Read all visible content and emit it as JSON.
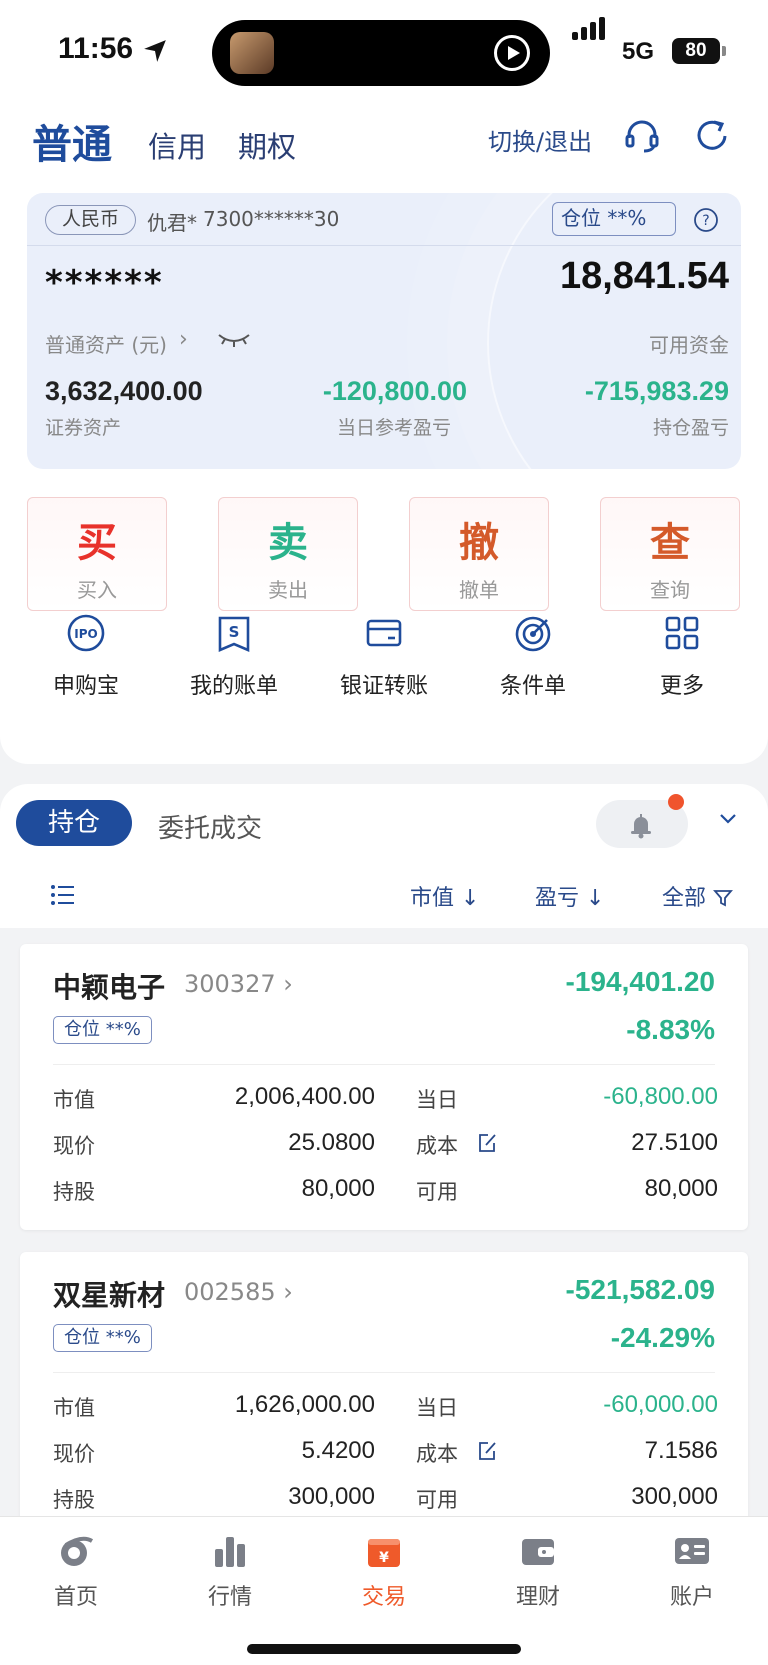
{
  "status": {
    "time": "11:56",
    "network": "5G",
    "battery": "80"
  },
  "header": {
    "tabs": [
      "普通",
      "信用",
      "期权"
    ],
    "switch_label": "切换/退出"
  },
  "account": {
    "currency": "人民币",
    "name": "仇君*",
    "number": "7300******30",
    "position_label": "仓位 **%",
    "masked_total": "******",
    "available_cash": "18,841.54",
    "asset_label": "普通资产 (元)",
    "cash_label": "可用资金",
    "securities_assets": "3,632,400.00",
    "securities_label": "证券资产",
    "today_pl": "-120,800.00",
    "today_pl_label": "当日参考盈亏",
    "holding_pl": "-715,983.29",
    "holding_pl_label": "持仓盈亏"
  },
  "trade_buttons": [
    {
      "big": "买",
      "small": "买入",
      "color": "#e8322b"
    },
    {
      "big": "卖",
      "small": "卖出",
      "color": "#2bb38c"
    },
    {
      "big": "撤",
      "small": "撤单",
      "color": "#d45a2a"
    },
    {
      "big": "查",
      "small": "查询",
      "color": "#d45a2a"
    }
  ],
  "quick_actions": [
    "申购宝",
    "我的账单",
    "银证转账",
    "条件单",
    "更多"
  ],
  "holdings_tabs": {
    "active": "持仓",
    "other": "委托成交"
  },
  "sort": {
    "market_value": "市值 ↓",
    "pl": "盈亏 ↓",
    "filter": "全部"
  },
  "stocks": [
    {
      "name": "中颖电子",
      "code": "300327",
      "pl": "-194,401.20",
      "pct": "-8.83%",
      "position": "仓位 **%",
      "market_value_label": "市值",
      "market_value": "2,006,400.00",
      "today_label": "当日",
      "today": "-60,800.00",
      "price_label": "现价",
      "price": "25.0800",
      "cost_label": "成本",
      "cost": "27.5100",
      "shares_label": "持股",
      "shares": "80,000",
      "available_label": "可用",
      "available": "80,000"
    },
    {
      "name": "双星新材",
      "code": "002585",
      "pl": "-521,582.09",
      "pct": "-24.29%",
      "position": "仓位 **%",
      "market_value_label": "市值",
      "market_value": "1,626,000.00",
      "today_label": "当日",
      "today": "-60,000.00",
      "price_label": "现价",
      "price": "5.4200",
      "cost_label": "成本",
      "cost": "7.1586",
      "shares_label": "持股",
      "shares": "300,000",
      "available_label": "可用",
      "available": "300,000"
    }
  ],
  "bottom_nav": [
    {
      "label": "首页",
      "icon": "home-icon"
    },
    {
      "label": "行情",
      "icon": "market-chart-icon"
    },
    {
      "label": "交易",
      "icon": "trade-wallet-icon",
      "active": true
    },
    {
      "label": "理财",
      "icon": "wealth-wallet-icon"
    },
    {
      "label": "账户",
      "icon": "account-card-icon"
    }
  ],
  "colors": {
    "brand": "#1f4c9c",
    "loss": "#2bb38c",
    "active_nav": "#ef5a2a"
  }
}
